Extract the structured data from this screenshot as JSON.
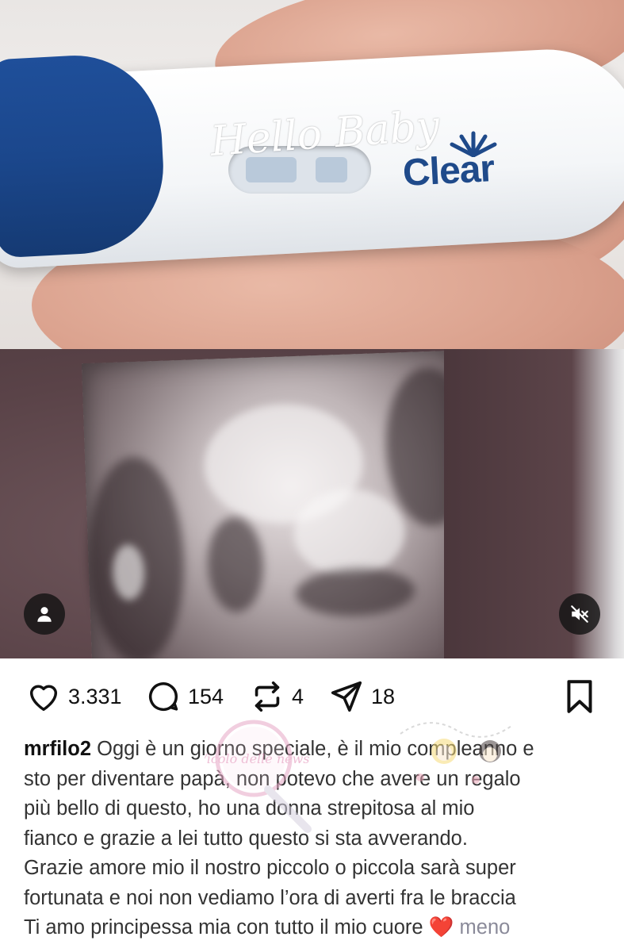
{
  "media": {
    "photo_1": {
      "brand_script": "Hello Baby",
      "brand_logo": "Clear"
    },
    "user_tag_icon": "person-icon",
    "mute_icon": "speaker-muted-icon"
  },
  "actions": {
    "likes": "3.331",
    "comments": "154",
    "reposts": "4",
    "shares": "18"
  },
  "caption": {
    "username": "mrfilo2",
    "lines": [
      "Oggi è un giorno speciale, è il mio compleanno e",
      "sto per diventare papà, non potevo che avere un regalo",
      "più bello  di questo, ho una donna strepitosa al mio",
      "fianco e grazie a lei tutto questo si sta avverando.",
      "Grazie amore mio il nostro piccolo o piccola sarà super",
      "fortunata e noi non vediamo l’ora di averti fra le braccia",
      "Ti amo principessa mia con tutto il mio cuore"
    ],
    "heart_emoji": "❤️",
    "more_label": "meno"
  },
  "watermark": {
    "text": "Vicolo delle news"
  },
  "colors": {
    "cap_blue": "#1b478c",
    "logo_blue": "#1f4a8a",
    "heart_red": "#e0212b",
    "more_gray": "#8a8a99"
  }
}
